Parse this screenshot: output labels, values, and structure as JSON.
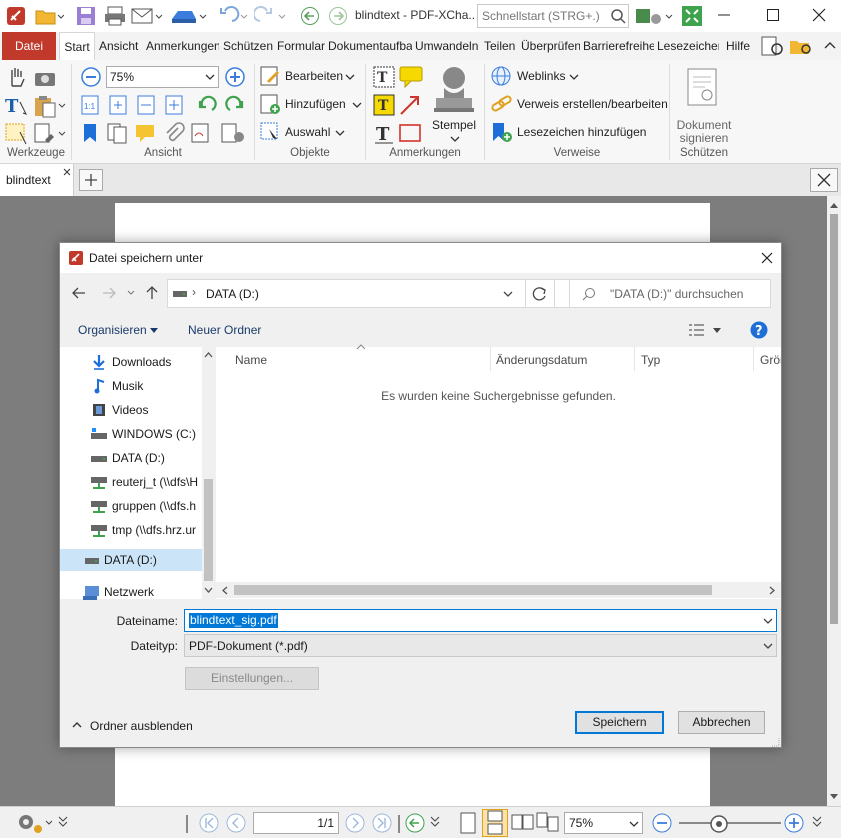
{
  "window": {
    "title": "blindtext - PDF-XCha...",
    "quick_search_placeholder": "Schnellstart (STRG+.)"
  },
  "ribbon_tabs": [
    "Datei",
    "Start",
    "Ansicht",
    "Anmerkungen",
    "Schützen",
    "Formular",
    "Dokumentaufbau",
    "Umwandeln",
    "Teilen",
    "Überprüfen",
    "Barrierefreiheit",
    "Lesezeichen",
    "Hilfe"
  ],
  "ribbon": {
    "zoom_value": "75%",
    "objekte": {
      "bearbeiten": "Bearbeiten",
      "hinzufuegen": "Hinzufügen",
      "auswahl": "Auswahl"
    },
    "stempel": "Stempel",
    "verweise": {
      "weblinks": "Weblinks",
      "verweis": "Verweis erstellen/bearbeiten",
      "lesezeichen": "Lesezeichen hinzufügen"
    },
    "dokument_signieren": [
      "Dokument",
      "signieren"
    ],
    "groups": {
      "werkzeuge": "Werkzeuge",
      "ansicht": "Ansicht",
      "objekte": "Objekte",
      "anmerkungen": "Anmerkungen",
      "verweise": "Verweise",
      "schuetzen": "Schützen"
    }
  },
  "doc_tab": {
    "label": "blindtext"
  },
  "dialog": {
    "title": "Datei speichern unter",
    "address": "DATA (D:)",
    "search_placeholder": "\"DATA (D:)\" durchsuchen",
    "organize": "Organisieren",
    "new_folder": "Neuer Ordner",
    "nav_items": [
      "Downloads",
      "Musik",
      "Videos",
      "WINDOWS (C:)",
      "DATA (D:)",
      "reuterj_t (\\\\dfs\\H",
      "gruppen (\\\\dfs.h",
      "tmp (\\\\dfs.hrz.ur"
    ],
    "nav_selected": "DATA (D:)",
    "nav_network": "Netzwerk",
    "columns": [
      "Name",
      "Änderungsdatum",
      "Typ",
      "Größe"
    ],
    "empty_message": "Es wurden keine Suchergebnisse gefunden.",
    "filename_label": "Dateiname:",
    "filename_value": "blindtext_sig.pdf",
    "filetype_label": "Dateityp:",
    "filetype_value": "PDF-Dokument (*.pdf)",
    "settings_button": "Einstellungen...",
    "hide_folders": "Ordner ausblenden",
    "save_button": "Speichern",
    "cancel_button": "Abbrechen"
  },
  "statusbar": {
    "page_display": "1/1",
    "zoom_value": "75%"
  },
  "colors": {
    "datei_tab": "#c0392b",
    "accent": "#0078d7",
    "selection": "#0078d7",
    "doc_bg": "#7d7d7d"
  }
}
